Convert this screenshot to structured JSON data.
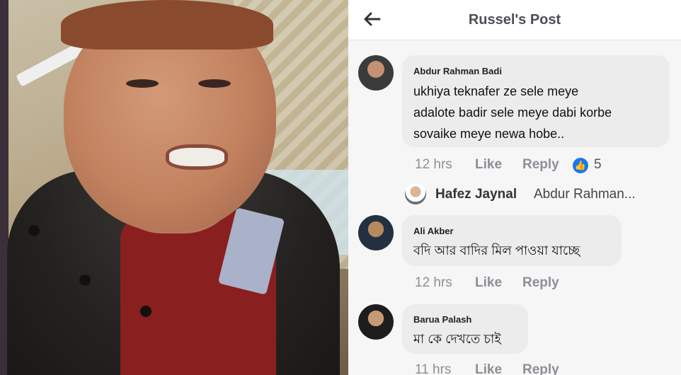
{
  "header": {
    "title": "Russel's Post"
  },
  "comments": [
    {
      "author": "Abdur Rahman Badi",
      "lines": [
        "ukhiya teknafer  ze sele meye",
        "adalote badir sele meye dabi korbe",
        "sovaike meye newa hobe.."
      ],
      "time": "12 hrs",
      "like_label": "Like",
      "reply_label": "Reply",
      "reaction_count": "5",
      "reply_preview": {
        "author": "Hafez Jaynal",
        "text": "Abdur Rahman..."
      }
    },
    {
      "author": "Ali Akber",
      "lines": [
        "বদি আর বাদির মিল পাওয়া যাচ্ছে"
      ],
      "time": "12 hrs",
      "like_label": "Like",
      "reply_label": "Reply"
    },
    {
      "author": "Barua Palash",
      "lines": [
        "মা কে দেখতে চাই"
      ],
      "time": "11 hrs",
      "like_label": "Like",
      "reply_label": "Reply"
    }
  ],
  "colors": {
    "accent": "#1877f2",
    "bubble": "#ececec",
    "meta": "#8b8f96"
  },
  "icons": {
    "back": "arrow-left-icon",
    "reaction": "like-reaction-icon"
  }
}
